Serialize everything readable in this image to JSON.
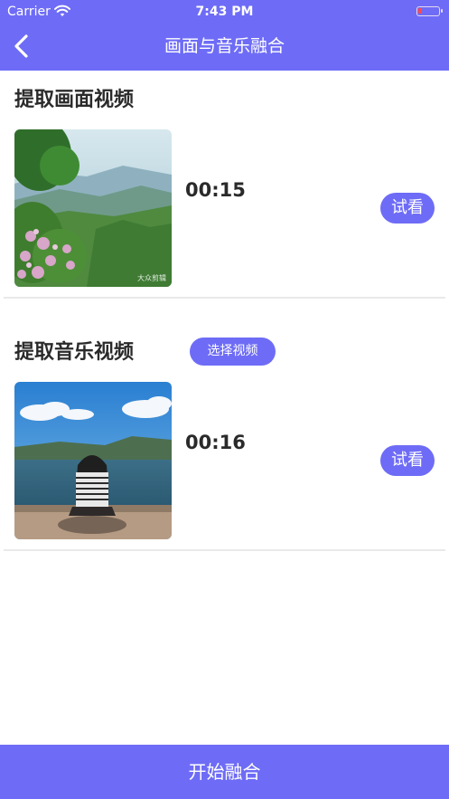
{
  "status_bar": {
    "carrier": "Carrier",
    "time": "7:43 PM"
  },
  "nav": {
    "title": "画面与音乐融合"
  },
  "sections": [
    {
      "title": "提取画面视频",
      "duration": "00:15",
      "try_label": "试看",
      "watermark": "大众剪辑"
    },
    {
      "title": "提取音乐视频",
      "pick_label": "选择视频",
      "duration": "00:16",
      "try_label": "试看"
    }
  ],
  "footer": {
    "start_label": "开始融合"
  },
  "colors": {
    "accent": "#6e6cf6",
    "divider": "#e9e9e9"
  }
}
